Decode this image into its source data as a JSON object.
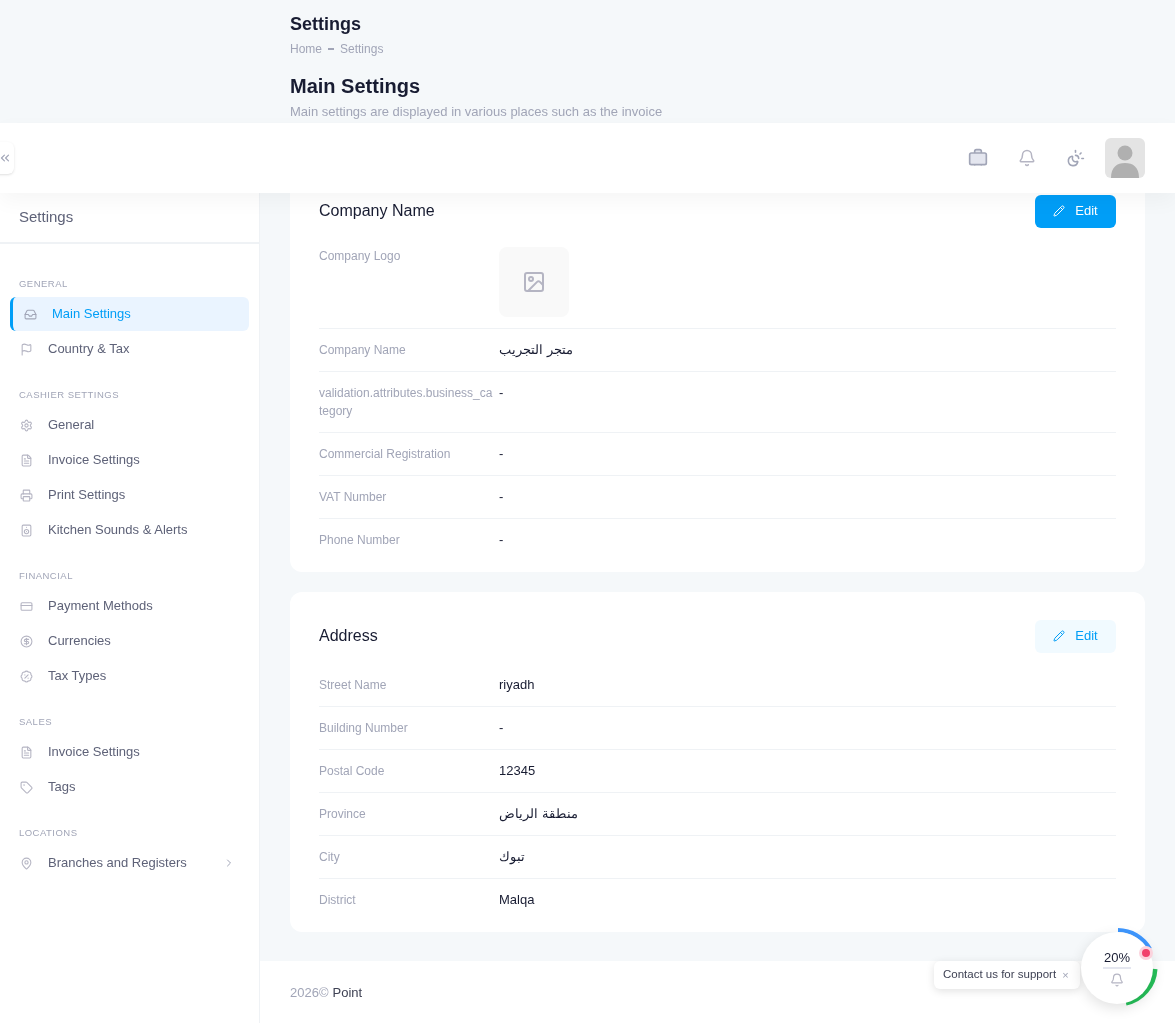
{
  "page_header": {
    "title": "Settings",
    "breadcrumb": [
      "Home",
      "Settings"
    ],
    "section_title": "Main Settings",
    "section_description": "Main settings are displayed in various places such as the invoice"
  },
  "sidebar": {
    "title": "Settings",
    "sections": [
      {
        "label": "GENERAL",
        "items": [
          {
            "label": "Main Settings",
            "selected": true,
            "kind": "link"
          },
          {
            "label": "Country & Tax",
            "selected": false,
            "kind": "link"
          }
        ]
      },
      {
        "label": "CASHIER SETTINGS",
        "items": [
          {
            "label": "General",
            "selected": false,
            "kind": "link"
          },
          {
            "label": "Invoice Settings",
            "selected": false,
            "kind": "link"
          },
          {
            "label": "Print Settings",
            "selected": false,
            "kind": "link"
          },
          {
            "label": "Kitchen Sounds & Alerts",
            "selected": false,
            "kind": "link"
          }
        ]
      },
      {
        "label": "FINANCIAL",
        "items": [
          {
            "label": "Payment Methods",
            "selected": false,
            "kind": "link"
          },
          {
            "label": "Currencies",
            "selected": false,
            "kind": "link"
          },
          {
            "label": "Tax Types",
            "selected": false,
            "kind": "link"
          }
        ]
      },
      {
        "label": "SALES",
        "items": [
          {
            "label": "Invoice Settings",
            "selected": false,
            "kind": "link"
          },
          {
            "label": "Tags",
            "selected": false,
            "kind": "link"
          }
        ]
      },
      {
        "label": "LOCATIONS",
        "items": [
          {
            "label": "Branches and Registers",
            "selected": false,
            "kind": "submenu"
          }
        ]
      }
    ]
  },
  "cards": [
    {
      "title": "Company Name",
      "edit_button": {
        "label": "Edit",
        "kind": "primary"
      },
      "rows": [
        {
          "kind": "logo",
          "label": "Company Logo"
        },
        {
          "kind": "text",
          "label": "Company Name",
          "value": "متجر التجريب"
        },
        {
          "kind": "text",
          "label": "validation.attributes.business_category",
          "value": "-"
        },
        {
          "kind": "text",
          "label": "Commercial Registration",
          "value": "-"
        },
        {
          "kind": "text",
          "label": "VAT Number",
          "value": "-"
        },
        {
          "kind": "text",
          "label": "Phone Number",
          "value": "-"
        }
      ]
    },
    {
      "title": "Address",
      "edit_button": {
        "label": "Edit",
        "kind": "light"
      },
      "rows": [
        {
          "kind": "text",
          "label": "Street Name",
          "value": "riyadh"
        },
        {
          "kind": "text",
          "label": "Building Number",
          "value": "-"
        },
        {
          "kind": "text",
          "label": "Postal Code",
          "value": "12345"
        },
        {
          "kind": "text",
          "label": "Province",
          "value": "منطقة الرياض"
        },
        {
          "kind": "text",
          "label": "City",
          "value": "تبوك"
        },
        {
          "kind": "text",
          "label": "District",
          "value": "Malqa"
        }
      ]
    }
  ],
  "footer": {
    "year": "2026©",
    "brand": "Point"
  },
  "support_widget": {
    "message": "Contact us for support",
    "close": "×",
    "progress": "20%"
  }
}
